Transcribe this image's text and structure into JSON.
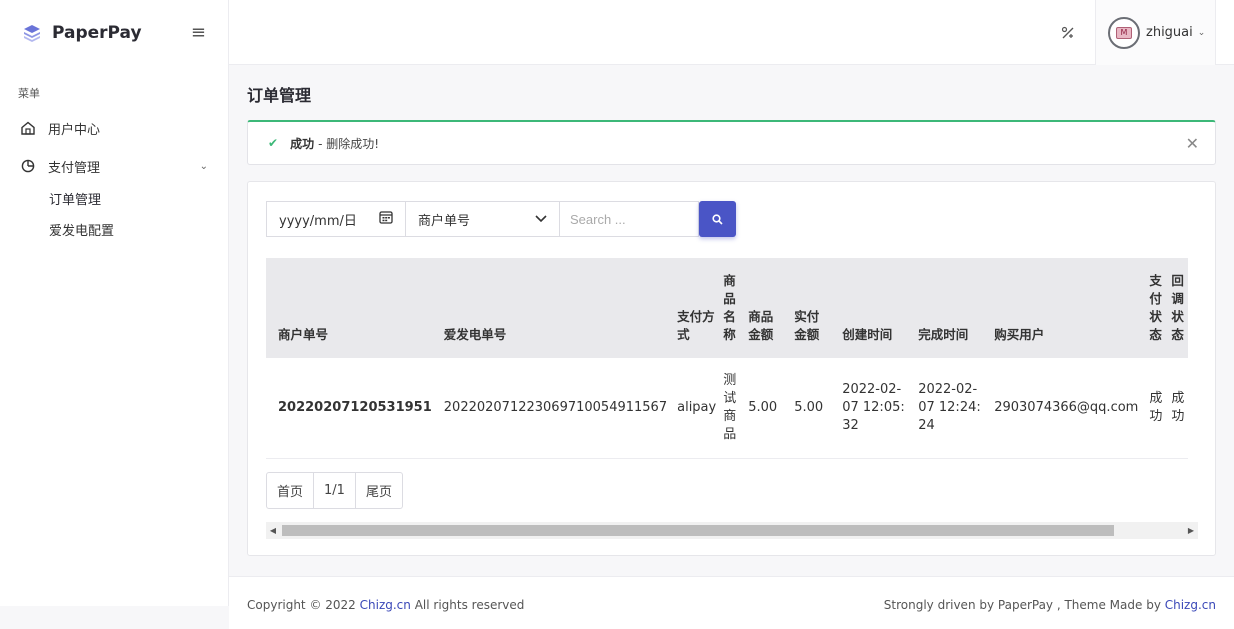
{
  "brand": {
    "name": "PaperPay"
  },
  "sidebar": {
    "section_label": "菜单",
    "items": [
      {
        "label": "用户中心",
        "icon": "home-icon"
      },
      {
        "label": "支付管理",
        "icon": "pie-chart-icon",
        "expanded": true,
        "children": [
          {
            "label": "订单管理",
            "active": true
          },
          {
            "label": "爱发电配置"
          }
        ]
      }
    ]
  },
  "topbar": {
    "username": "zhiguai"
  },
  "page": {
    "title": "订单管理"
  },
  "alert": {
    "title": "成功",
    "message": "- 删除成功!"
  },
  "filters": {
    "date_placeholder": "yyyy/mm/日",
    "select_value": "商户单号",
    "search_placeholder": "Search ..."
  },
  "table": {
    "headers": [
      "商户单号",
      "爱发电单号",
      "支付方式",
      "商品名称",
      "商品金额",
      "实付金额",
      "创建时间",
      "完成时间",
      "购买用户",
      "支付状态",
      "回调状态"
    ],
    "rows": [
      {
        "merchant_no": "20220207120531951",
        "afdian_no": "202202071223069710054911567",
        "pay_method": "alipay",
        "product_name": "测试商品",
        "product_amount": "5.00",
        "paid_amount": "5.00",
        "created_at": "2022-02-07 12:05:32",
        "finished_at": "2022-02-07 12:24:24",
        "buyer": "2903074366@qq.com",
        "pay_status": "成功",
        "callback_status": "成功"
      }
    ]
  },
  "pager": {
    "first": "首页",
    "current": "1/1",
    "last": "尾页"
  },
  "footer": {
    "copyright_prefix": "Copyright © 2022 ",
    "copyright_link": "Chizg.cn",
    "copyright_suffix": " All rights reserved",
    "right_prefix": "Strongly driven by PaperPay , Theme Made by ",
    "right_link": "Chizg.cn"
  },
  "colors": {
    "accent": "#4a55c6",
    "success": "#3cb878",
    "header_bg": "#e9e9ec"
  }
}
